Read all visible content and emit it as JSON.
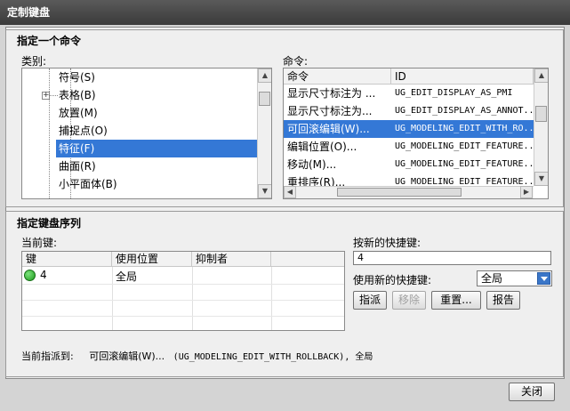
{
  "window": {
    "title": "定制键盘"
  },
  "section_command": {
    "title": "指定一个命令",
    "category_label": "类别:",
    "command_label": "命令:",
    "categories": [
      {
        "label": "符号(S)"
      },
      {
        "label": "表格(B)"
      },
      {
        "label": "放置(M)"
      },
      {
        "label": "捕捉点(O)"
      },
      {
        "label": "特征(F)",
        "selected": true
      },
      {
        "label": "曲面(R)"
      },
      {
        "label": "小平面体(B)"
      }
    ],
    "columns": [
      "命令",
      "ID"
    ],
    "commands": [
      {
        "name": "显示尺寸标注为 ...",
        "id": "UG_EDIT_DISPLAY_AS_PMI"
      },
      {
        "name": "显示尺寸标注为...",
        "id": "UG_EDIT_DISPLAY_AS_ANNOT.."
      },
      {
        "name": "可回滚编辑(W)...",
        "id": "UG_MODELING_EDIT_WITH_RO..",
        "selected": true
      },
      {
        "name": "编辑位置(O)...",
        "id": "UG_MODELING_EDIT_FEATURE.."
      },
      {
        "name": "移动(M)...",
        "id": "UG_MODELING_EDIT_FEATURE.."
      },
      {
        "name": "重排序(R)...",
        "id": "UG_MODELING_EDIT_FEATURE.."
      }
    ]
  },
  "section_keys": {
    "title": "指定键盘序列",
    "current_keys_label": "当前键:",
    "columns": [
      "键",
      "使用位置",
      "抑制者",
      ""
    ],
    "rows": [
      {
        "key": "4",
        "location": "全局",
        "suppressor": ""
      }
    ],
    "new_shortcut_label": "按新的快捷键:",
    "new_shortcut_value": "4",
    "use_new_label": "使用新的快捷键:",
    "use_new_value": "全局",
    "buttons": {
      "assign": "指派",
      "remove": "移除",
      "reset": "重置...",
      "report": "报告"
    },
    "status_label": "当前指派到:",
    "status_value": "可回滚编辑(W)...",
    "status_detail": "(UG_MODELING_EDIT_WITH_ROLLBACK), 全局"
  },
  "footer": {
    "close": "关闭"
  }
}
